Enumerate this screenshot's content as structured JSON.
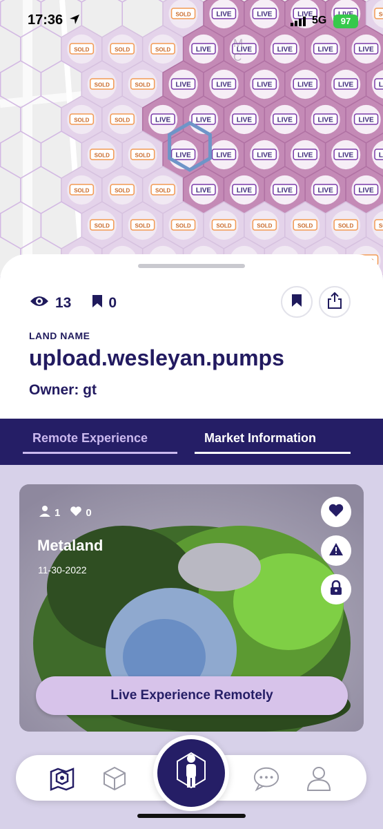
{
  "status": {
    "time": "17:36",
    "network": "5G",
    "battery": "97"
  },
  "map": {
    "badges": {
      "sold": "SOLD",
      "live": "LIVE"
    },
    "label_lines": [
      "M",
      "C"
    ]
  },
  "sheet": {
    "views": "13",
    "bookmarks": "0",
    "land_label": "LAND NAME",
    "land_name": "upload.wesleyan.pumps",
    "owner": "Owner: gt"
  },
  "tabs": {
    "remote": "Remote Experience",
    "market": "Market Information"
  },
  "experience": {
    "visitors": "1",
    "likes": "0",
    "title": "Metaland",
    "date": "11-30-2022",
    "live_button": "Live Experience Remotely"
  },
  "colors": {
    "brand": "#251e66",
    "accent": "#d7c3ea",
    "live_purple": "#7a3aa8",
    "sold_orange": "#f39a52"
  },
  "nav": {
    "icons": [
      "map-icon",
      "cube-icon",
      "avatar-icon",
      "chat-icon",
      "profile-icon"
    ]
  }
}
